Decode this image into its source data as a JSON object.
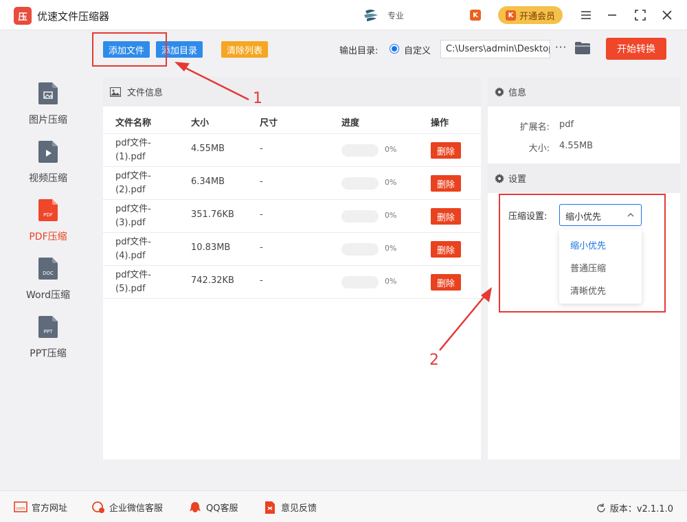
{
  "app": {
    "title": "优速文件压缩器",
    "logo_char": "压"
  },
  "header": {
    "user_name": "专业",
    "vip_mini_icon": "K",
    "vip_label": "开通会员",
    "vip_icon": "K",
    "window_controls": [
      "menu-icon",
      "minimize-icon",
      "maximize-icon",
      "close-icon"
    ]
  },
  "sidebar": {
    "items": [
      {
        "label": "图片压缩",
        "icon": "image-file-icon",
        "badge": ""
      },
      {
        "label": "视频压缩",
        "icon": "video-file-icon",
        "badge": ""
      },
      {
        "label": "PDF压缩",
        "icon": "pdf-file-icon",
        "badge": "PDF",
        "active": true
      },
      {
        "label": "Word压缩",
        "icon": "doc-file-icon",
        "badge": "DOC"
      },
      {
        "label": "PPT压缩",
        "icon": "ppt-file-icon",
        "badge": "PPT"
      }
    ]
  },
  "toolbar": {
    "add_file": "添加文件",
    "add_folder": "添加目录",
    "clear_list": "清除列表",
    "output_label": "输出目录:",
    "radio_label": "自定义",
    "output_path": "C:\\Users\\admin\\Desktop",
    "more": "···",
    "start": "开始转换"
  },
  "file_panel": {
    "title": "文件信息",
    "columns": [
      "文件名称",
      "大小",
      "尺寸",
      "进度",
      "操作"
    ],
    "rows": [
      {
        "name_line1": "pdf文件-",
        "name_line2": "(1).pdf",
        "size": "4.55MB",
        "dim": "-",
        "progress": 0,
        "pct": "0%",
        "action": "删除"
      },
      {
        "name_line1": "pdf文件-",
        "name_line2": "(2).pdf",
        "size": "6.34MB",
        "dim": "-",
        "progress": 0,
        "pct": "0%",
        "action": "删除"
      },
      {
        "name_line1": "pdf文件-",
        "name_line2": "(3).pdf",
        "size": "351.76KB",
        "dim": "-",
        "progress": 0,
        "pct": "0%",
        "action": "删除"
      },
      {
        "name_line1": "pdf文件-",
        "name_line2": "(4).pdf",
        "size": "10.83MB",
        "dim": "-",
        "progress": 0,
        "pct": "0%",
        "action": "删除"
      },
      {
        "name_line1": "pdf文件-",
        "name_line2": "(5).pdf",
        "size": "742.32KB",
        "dim": "-",
        "progress": 0,
        "pct": "0%",
        "action": "删除"
      }
    ]
  },
  "info_panel": {
    "title": "信息",
    "ext_key": "扩展名:",
    "ext_val": "pdf",
    "size_key": "大小:",
    "size_val": "4.55MB"
  },
  "settings_panel": {
    "title": "设置",
    "label": "压缩设置:",
    "selected": "缩小优先",
    "options": [
      "缩小优先",
      "普通压缩",
      "清晰优先"
    ]
  },
  "annotations": {
    "label_1": "1",
    "label_2": "2",
    "color": "#e53935"
  },
  "footer": {
    "links": [
      {
        "label": "官方网址",
        "icon": "website-icon"
      },
      {
        "label": "企业微信客服",
        "icon": "wechat-service-icon"
      },
      {
        "label": "QQ客服",
        "icon": "qq-icon"
      },
      {
        "label": "意见反馈",
        "icon": "feedback-icon"
      }
    ],
    "version": "版本：v2.1.1.0"
  },
  "colors": {
    "accent_red": "#e9421f",
    "accent_blue": "#1a73e8",
    "orange": "#f5a623",
    "vip_gold": "#f5c14a"
  }
}
